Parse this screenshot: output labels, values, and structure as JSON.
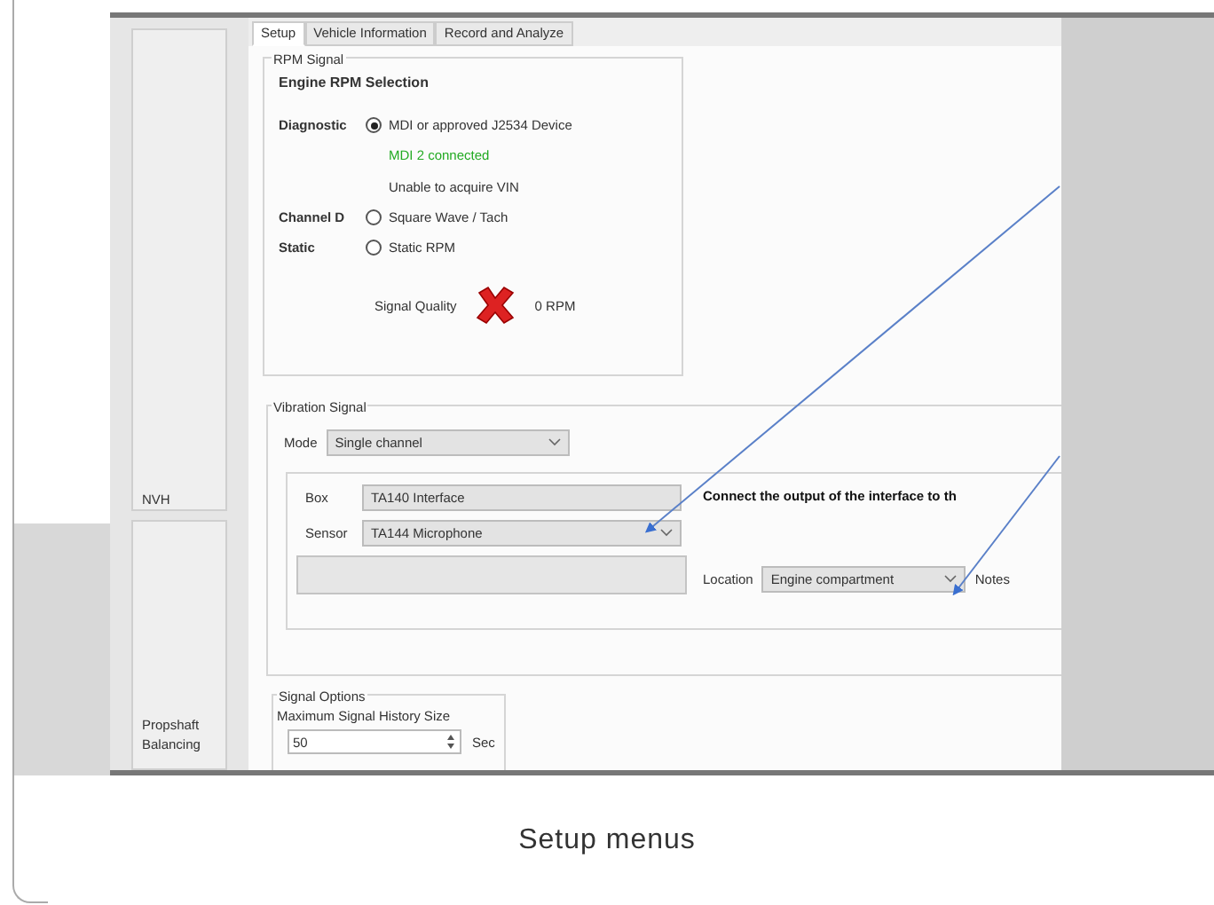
{
  "sidebar": {
    "items": [
      {
        "label": "NVH"
      },
      {
        "label": "Propshaft Balancing"
      }
    ]
  },
  "tabs": [
    {
      "label": "Setup",
      "selected": true
    },
    {
      "label": "Vehicle Information",
      "selected": false
    },
    {
      "label": "Record and Analyze",
      "selected": false
    }
  ],
  "rpm_signal": {
    "title": "RPM Signal",
    "heading": "Engine RPM Selection",
    "options": [
      {
        "label": "Diagnostic",
        "option": "MDI or approved J2534 Device",
        "selected": true,
        "status": [
          {
            "text": "MDI 2 connected",
            "color": "#22aa22"
          },
          {
            "text": "Unable to acquire VIN",
            "color": "#333333"
          }
        ]
      },
      {
        "label": "Channel D",
        "option": "Square Wave / Tach",
        "selected": false
      },
      {
        "label": "Static",
        "option": "Static RPM",
        "selected": false
      }
    ],
    "quality_label": "Signal Quality",
    "reading": "0 RPM"
  },
  "vibration_signal": {
    "title": "Vibration Signal",
    "mode_label": "Mode",
    "mode": "Single channel",
    "box_label": "Box",
    "box": "TA140 Interface",
    "sensor_label": "Sensor",
    "sensor": "TA144 Microphone",
    "instruction": "Connect the output of the interface to th",
    "location_label": "Location",
    "location": "Engine compartment",
    "notes_label": "Notes"
  },
  "signal_options": {
    "title": "Signal Options",
    "label": "Maximum Signal History Size",
    "value": "50",
    "unit": "Sec"
  },
  "caption": "Setup menus"
}
